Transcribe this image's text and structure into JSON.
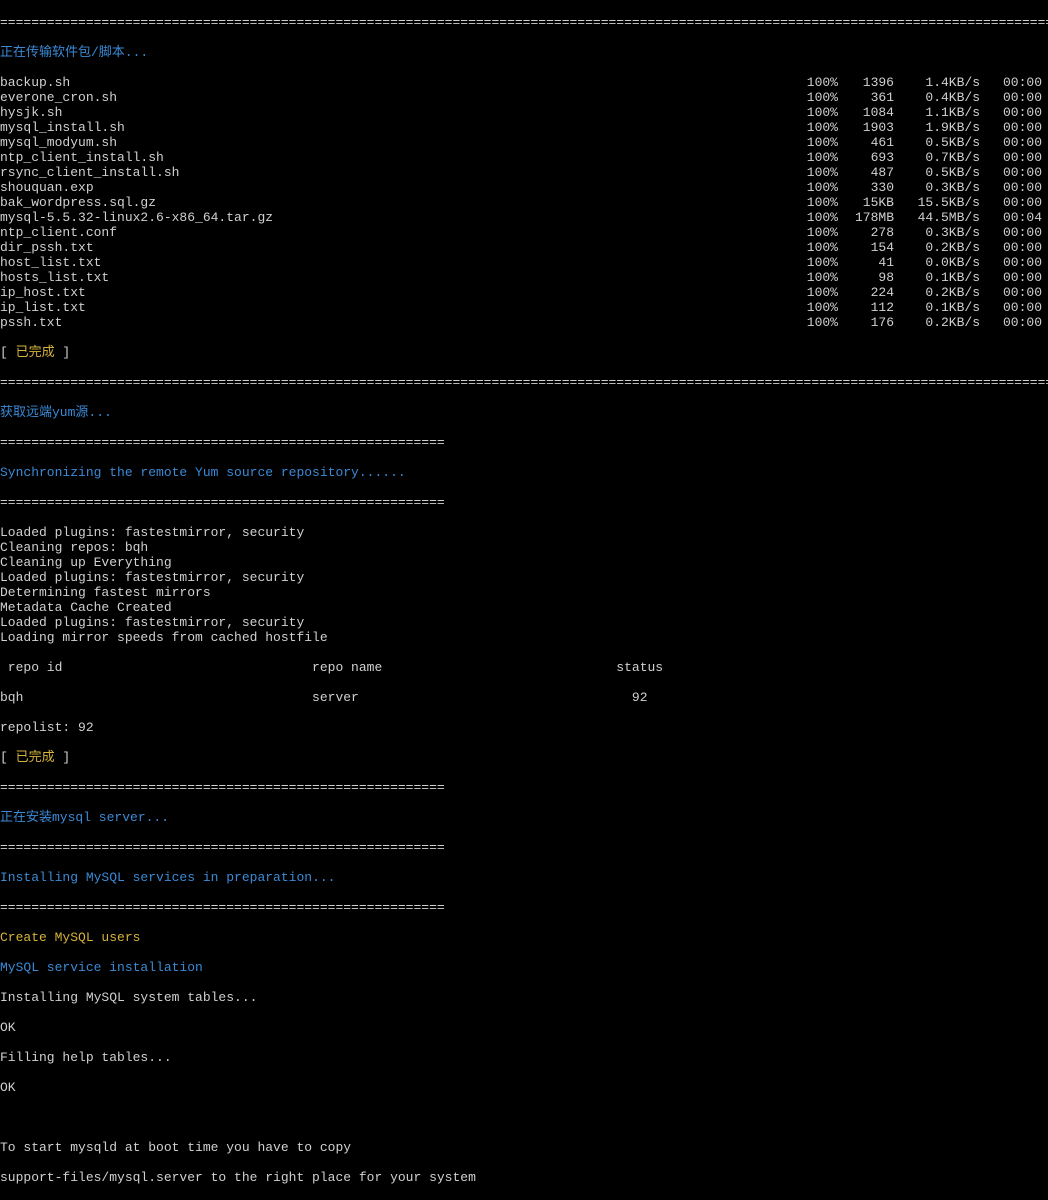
{
  "sep_long": "=====================================================================================================================================================",
  "sep_med": "=========================================================",
  "header_transfer": "正在传输软件包/脚本...",
  "transfer": [
    {
      "name": "backup.sh",
      "pct": "100%",
      "size": "1396",
      "speed": "1.4KB/s",
      "time": "00:00"
    },
    {
      "name": "everone_cron.sh",
      "pct": "100%",
      "size": "361",
      "speed": "0.4KB/s",
      "time": "00:00"
    },
    {
      "name": "hysjk.sh",
      "pct": "100%",
      "size": "1084",
      "speed": "1.1KB/s",
      "time": "00:00"
    },
    {
      "name": "mysql_install.sh",
      "pct": "100%",
      "size": "1903",
      "speed": "1.9KB/s",
      "time": "00:00"
    },
    {
      "name": "mysql_modyum.sh",
      "pct": "100%",
      "size": "461",
      "speed": "0.5KB/s",
      "time": "00:00"
    },
    {
      "name": "ntp_client_install.sh",
      "pct": "100%",
      "size": "693",
      "speed": "0.7KB/s",
      "time": "00:00"
    },
    {
      "name": "rsync_client_install.sh",
      "pct": "100%",
      "size": "487",
      "speed": "0.5KB/s",
      "time": "00:00"
    },
    {
      "name": "shouquan.exp",
      "pct": "100%",
      "size": "330",
      "speed": "0.3KB/s",
      "time": "00:00"
    },
    {
      "name": "bak_wordpress.sql.gz",
      "pct": "100%",
      "size": "15KB",
      "speed": "15.5KB/s",
      "time": "00:00"
    },
    {
      "name": "mysql-5.5.32-linux2.6-x86_64.tar.gz",
      "pct": "100%",
      "size": "178MB",
      "speed": "44.5MB/s",
      "time": "00:04"
    },
    {
      "name": "ntp_client.conf",
      "pct": "100%",
      "size": "278",
      "speed": "0.3KB/s",
      "time": "00:00"
    },
    {
      "name": "dir_pssh.txt",
      "pct": "100%",
      "size": "154",
      "speed": "0.2KB/s",
      "time": "00:00"
    },
    {
      "name": "host_list.txt",
      "pct": "100%",
      "size": "41",
      "speed": "0.0KB/s",
      "time": "00:00"
    },
    {
      "name": "hosts_list.txt",
      "pct": "100%",
      "size": "98",
      "speed": "0.1KB/s",
      "time": "00:00"
    },
    {
      "name": "ip_host.txt",
      "pct": "100%",
      "size": "224",
      "speed": "0.2KB/s",
      "time": "00:00"
    },
    {
      "name": "ip_list.txt",
      "pct": "100%",
      "size": "112",
      "speed": "0.1KB/s",
      "time": "00:00"
    },
    {
      "name": "pssh.txt",
      "pct": "100%",
      "size": "176",
      "speed": "0.2KB/s",
      "time": "00:00"
    }
  ],
  "done_bracket_open": "[ ",
  "done_label": "已完成",
  "done_bracket_close": " ]",
  "header_yum": "获取远端yum源...",
  "sync_msg": "Synchronizing the remote Yum source repository......",
  "yum_output": [
    "Loaded plugins: fastestmirror, security",
    "Cleaning repos: bqh",
    "Cleaning up Everything",
    "Loaded plugins: fastestmirror, security",
    "Determining fastest mirrors",
    "Metadata Cache Created",
    "Loaded plugins: fastestmirror, security",
    "Loading mirror speeds from cached hostfile"
  ],
  "repo_header": " repo id                                repo name                              status",
  "repo_row": "bqh                                     server                                   92",
  "repolist": "repolist: 92",
  "header_mysql": "正在安装mysql server...",
  "mysql_prep": "Installing MySQL services in preparation...",
  "mysql_create_users": "Create MySQL users",
  "mysql_service_install": "MySQL service installation",
  "mysql_tables1": "Installing MySQL system tables...",
  "ok": "OK",
  "mysql_tables2": "Filling help tables...",
  "boot_msg1": "To start mysqld at boot time you have to copy",
  "boot_msg2": "support-files/mysql.server to the right place for your system"
}
